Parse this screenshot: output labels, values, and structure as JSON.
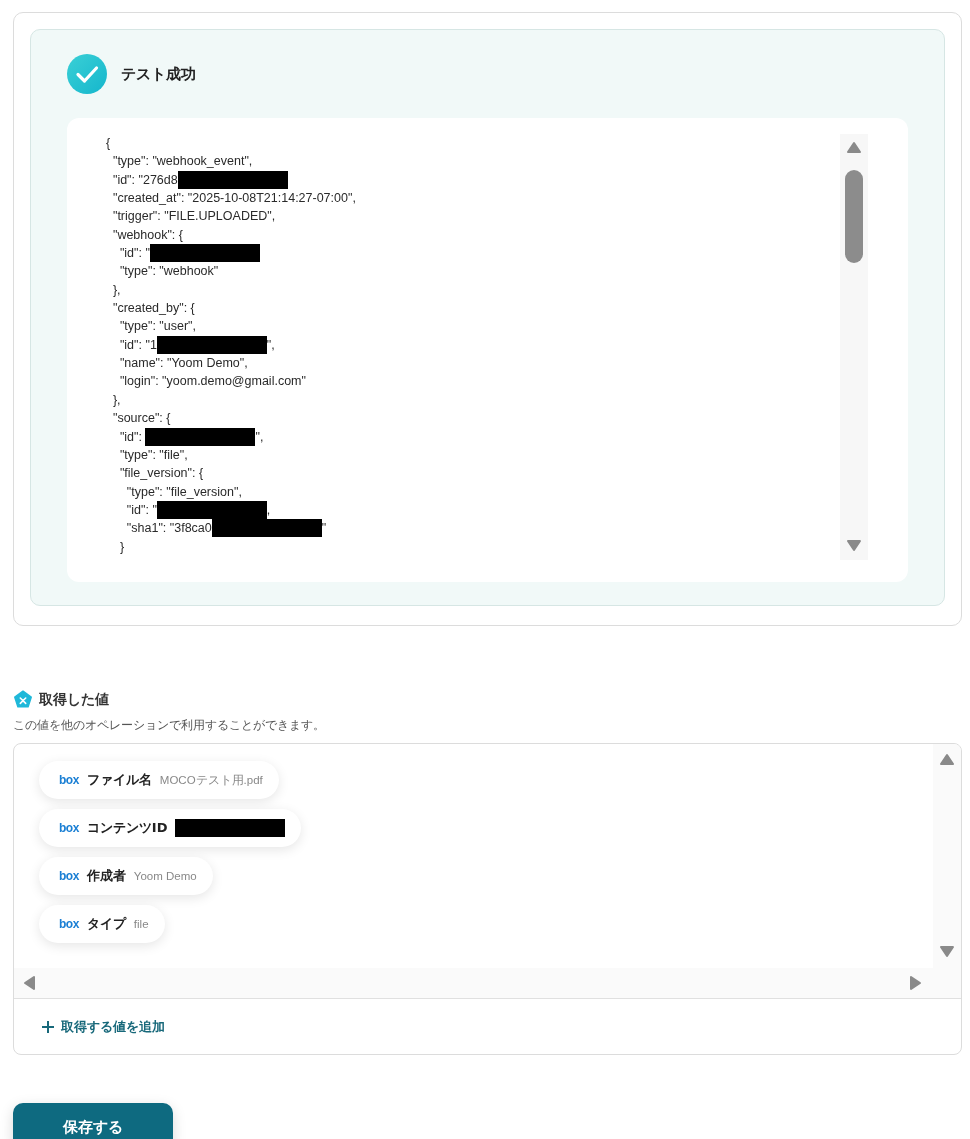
{
  "test_result": {
    "title": "テスト成功",
    "success": true,
    "lines": [
      {
        "text": "{"
      },
      {
        "text": "  \"type\": \"webhook_event\","
      },
      {
        "text": "  \"id\": \"276d8",
        "redacted": true
      },
      {
        "text": "  \"created_at\": \"2025-10-08T21:14:27-07:00\","
      },
      {
        "text": "  \"trigger\": \"FILE.UPLOADED\","
      },
      {
        "text": "  \"webhook\": {"
      },
      {
        "text": "    \"id\": \"",
        "redacted": true
      },
      {
        "text": "    \"type\": \"webhook\""
      },
      {
        "text": "  },"
      },
      {
        "text": "  \"created_by\": {"
      },
      {
        "text": "    \"type\": \"user\","
      },
      {
        "text": "    \"id\": \"1",
        "redacted": true,
        "after": "\","
      },
      {
        "text": "    \"name\": \"Yoom Demo\","
      },
      {
        "text": "    \"login\": \"yoom.demo@gmail.com\""
      },
      {
        "text": "  },"
      },
      {
        "text": "  \"source\": {"
      },
      {
        "text": "    \"id\": ",
        "redacted": true,
        "after": "\","
      },
      {
        "text": "    \"type\": \"file\","
      },
      {
        "text": "    \"file_version\": {"
      },
      {
        "text": "      \"type\": \"file_version\","
      },
      {
        "text": "      \"id\": \"",
        "redacted": true,
        "after": ","
      },
      {
        "text": "      \"sha1\": \"3f8ca0",
        "redacted": true,
        "after": "\""
      },
      {
        "text": "    }"
      }
    ]
  },
  "values_section": {
    "title": "取得した値",
    "description": "この値を他のオペレーションで利用することができます。",
    "chips": [
      {
        "logo": "box",
        "label": "ファイル名",
        "value": "MOCOテスト用.pdf"
      },
      {
        "logo": "box",
        "label": "コンテンツID",
        "redacted": true
      },
      {
        "logo": "box",
        "label": "作成者",
        "value": "Yoom Demo"
      },
      {
        "logo": "box",
        "label": "タイプ",
        "value": "file"
      }
    ],
    "add_link": "取得する値を追加"
  },
  "save_button": "保存する"
}
